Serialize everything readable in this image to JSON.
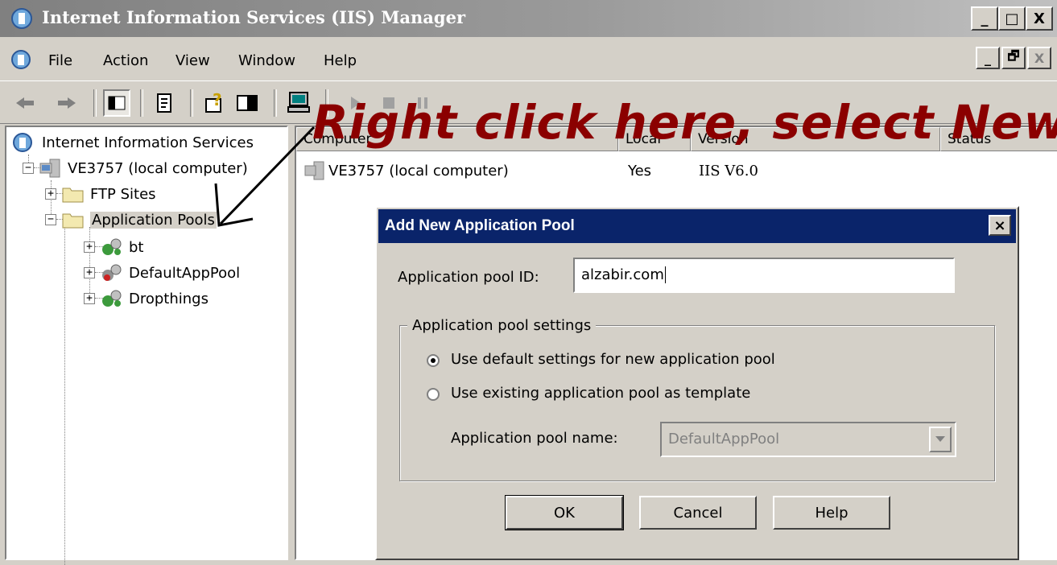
{
  "window": {
    "title": "Internet Information Services (IIS) Manager",
    "controls": [
      "_",
      "□",
      "X"
    ]
  },
  "menu": {
    "items": [
      {
        "label": "File"
      },
      {
        "label": "Action"
      },
      {
        "label": "View"
      },
      {
        "label": "Window"
      },
      {
        "label": "Help"
      }
    ],
    "mdi_controls": [
      "_",
      "🗗",
      "X"
    ]
  },
  "tree": {
    "root": "Internet Information Services",
    "computer": "VE3757 (local computer)",
    "ftp": "FTP Sites",
    "pools": "Application Pools",
    "children": [
      "bt",
      "DefaultAppPool",
      "Dropthings"
    ],
    "expanded_sign": "−",
    "collapsed_sign": "+"
  },
  "list": {
    "columns": [
      "Computer",
      "Local",
      "Version",
      "Status"
    ],
    "rows": [
      {
        "computer": "VE3757 (local computer)",
        "local": "Yes",
        "version": "IIS V6.0"
      }
    ]
  },
  "annotation": "Right click here, select New",
  "dialog": {
    "title": "Add New Application Pool",
    "close": "×",
    "pool_id_label": "Application pool ID:",
    "pool_id_value": "alzabir.com",
    "group_label": "Application pool settings",
    "radio_default": "Use default settings for new application pool",
    "radio_existing": "Use existing application pool as template",
    "pool_name_label": "Application pool name:",
    "pool_name_value": "DefaultAppPool",
    "ok": "OK",
    "cancel": "Cancel",
    "help": "Help"
  },
  "colors": {
    "dialog_title_bg": "#0a246a",
    "annotation": "#8b0000",
    "face": "#d4d0c8"
  }
}
